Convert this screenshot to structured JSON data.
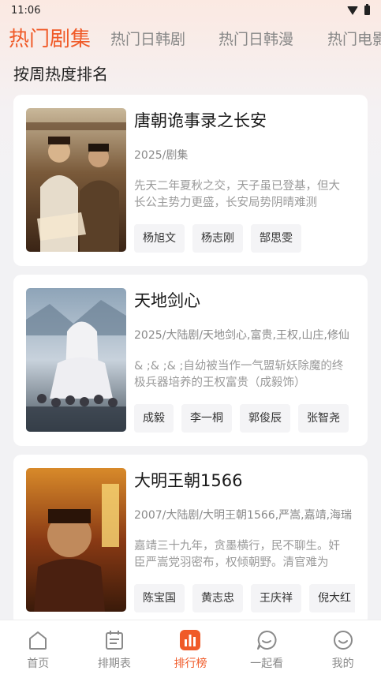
{
  "status_bar": {
    "time": "11:06"
  },
  "tabs": [
    {
      "label": "热门剧集",
      "active": true
    },
    {
      "label": "热门日韩剧",
      "active": false
    },
    {
      "label": "热门日韩漫",
      "active": false
    },
    {
      "label": "热门电影",
      "active": false
    }
  ],
  "section_title": "按周热度排名",
  "shows": [
    {
      "title": "唐朝诡事录之长安",
      "meta": "2025/剧集",
      "desc": "先天二年夏秋之交，天子虽已登基，但大长公主势力更盛，长安局势阴晴难测",
      "cast": [
        "杨旭文",
        "杨志刚",
        "郜思雯"
      ]
    },
    {
      "title": "天地剑心",
      "meta": "2025/大陆剧/天地剑心,富贵,王权,山庄,修仙",
      "desc": "&  ;&  ;&  ;自幼被当作一气盟斩妖除魔的终极兵器培养的王权富贵（成毅饰）",
      "cast": [
        "成毅",
        "李一桐",
        "郭俊辰",
        "张智尧"
      ]
    },
    {
      "title": "大明王朝1566",
      "meta": "2007/大陆剧/大明王朝1566,严嵩,嘉靖,海瑞",
      "desc": "嘉靖三十九年，贪墨横行，民不聊生。奸臣严嵩党羽密布，权倾朝野。清官难为",
      "cast": [
        "陈宝国",
        "黄志忠",
        "王庆祥",
        "倪大红"
      ]
    }
  ],
  "bottom_nav": [
    {
      "label": "首页",
      "icon": "home-icon",
      "active": false
    },
    {
      "label": "排期表",
      "icon": "schedule-icon",
      "active": false
    },
    {
      "label": "排行榜",
      "icon": "ranking-icon",
      "active": true
    },
    {
      "label": "一起看",
      "icon": "chat-icon",
      "active": false
    },
    {
      "label": "我的",
      "icon": "profile-icon",
      "active": false
    }
  ],
  "colors": {
    "accent": "#f05a28",
    "inactive": "#8a8a8a",
    "card_bg": "#ffffff"
  }
}
